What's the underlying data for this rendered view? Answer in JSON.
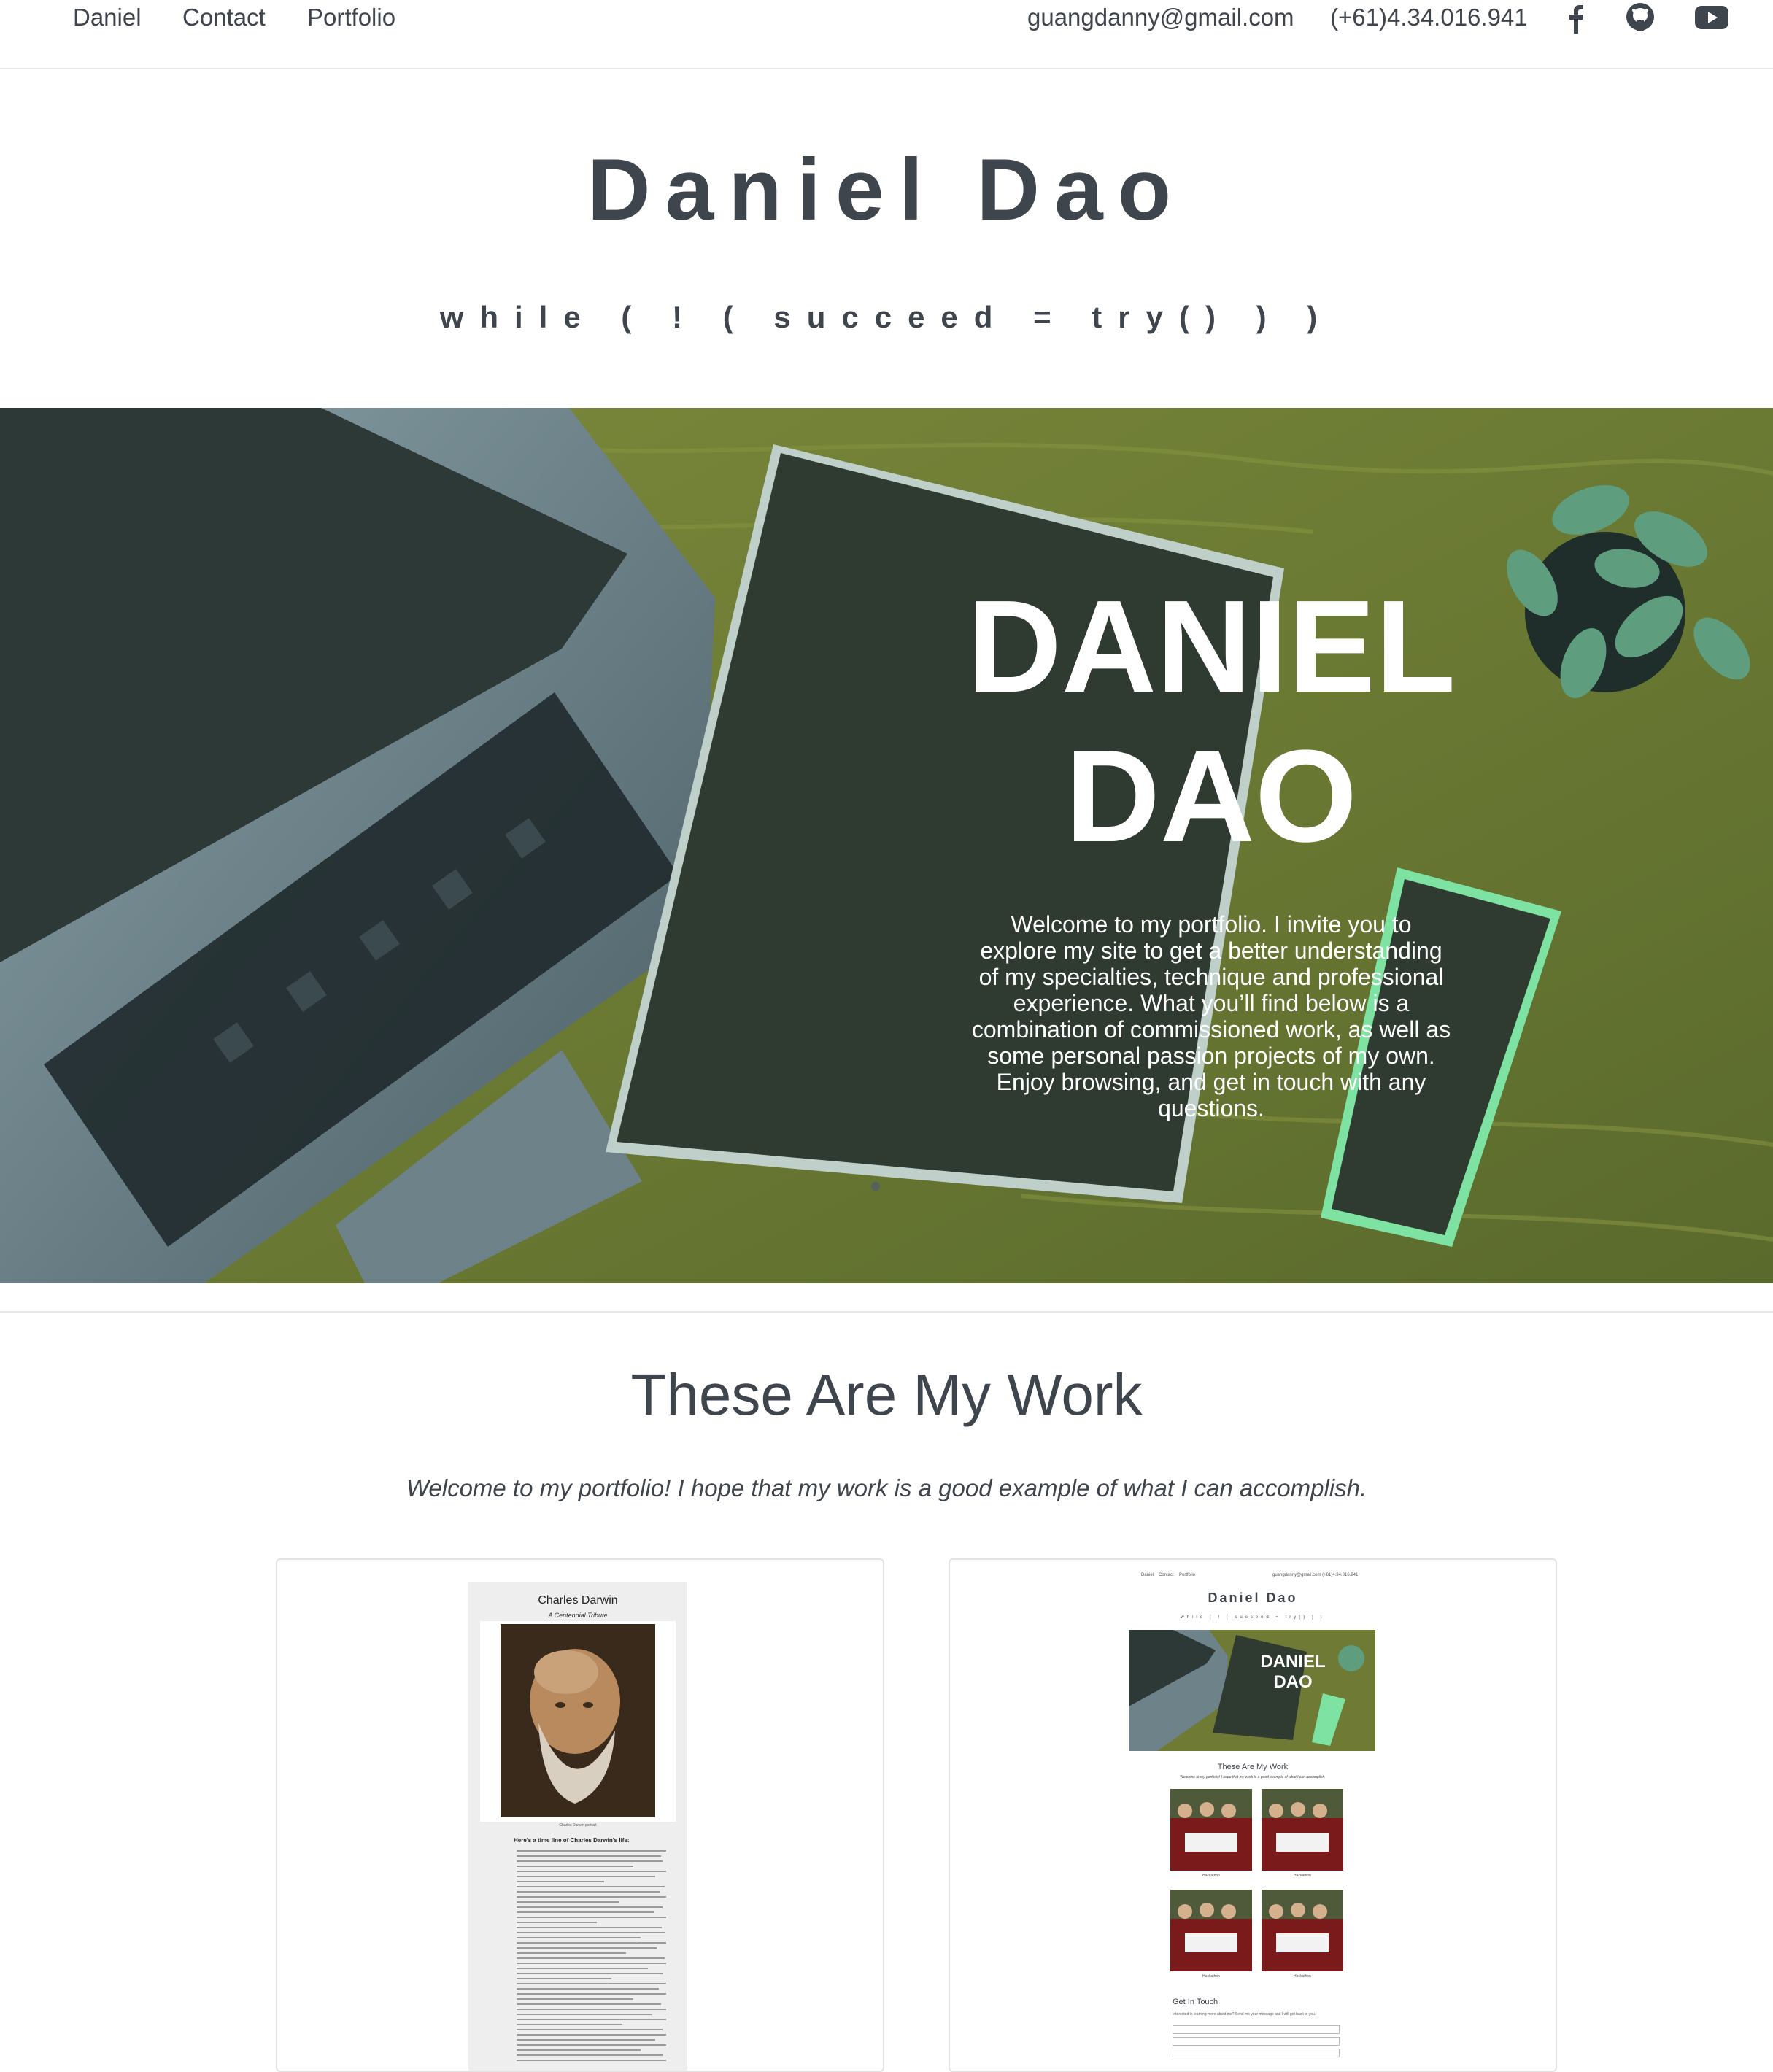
{
  "nav": {
    "links": [
      "Daniel",
      "Contact",
      "Portfolio"
    ],
    "email": "guangdanny@gmail.com",
    "phone": "(+61)4.34.016.941",
    "icons": [
      "facebook-icon",
      "github-icon",
      "youtube-icon"
    ]
  },
  "masthead": {
    "title": "Daniel Dao",
    "tagline": "while ( ! ( succeed = try() ) )"
  },
  "hero": {
    "name": "DANIEL DAO",
    "intro": "Welcome to my portfolio. I invite you to explore my site to get a better understanding of my specialties, technique and professional experience. What you’ll find below is a combination of commissioned work, as well as some personal passion projects of my own. Enjoy browsing, and get in touch with any questions."
  },
  "work": {
    "title": "These Are My Work",
    "subtitle": "Welcome to my portfolio! I hope that my work is a good example of what I can accomplish.",
    "cards": [
      {
        "thumb_title": "Charles Darwin",
        "thumb_subtitle": "A Centennial Tribute",
        "thumb_caption": "Charles Darwin portrait",
        "thumb_heading": "Here’s a time line of Charles Darwin’s life:"
      },
      {
        "mini_nav_links": [
          "Daniel",
          "Contact",
          "Portfolio"
        ],
        "mini_nav_right": "guangdanny@gmail.com   (+61)4.34.016.941",
        "mini_title": "Daniel Dao",
        "mini_tagline": "while ( ! ( succeed = try() ) )",
        "mini_hero_name": "DANIEL DAO",
        "mini_work_title": "These Are My Work",
        "mini_work_subtitle": "Welcome to my portfolio! I hope that my work is a good example of what I can accomplish.",
        "mini_captions": [
          "Hackathon",
          "Hackathon",
          "Hackathon",
          "Hackathon"
        ],
        "mini_contact_title": "Get In Touch",
        "mini_contact_sub": "Interested in learning more about me? Send me your message and I will get back to you."
      }
    ]
  },
  "colors": {
    "text": "#3f454d",
    "divider": "#e6e6e6",
    "hero_wood": "#6f7a34",
    "device_dark": "#2f3a30",
    "phone_green": "#7ee3a2"
  }
}
